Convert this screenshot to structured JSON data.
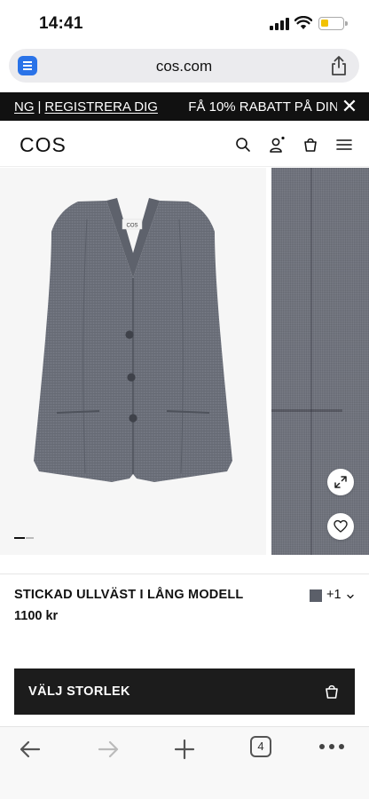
{
  "status_bar": {
    "time": "14:41"
  },
  "browser": {
    "url": "cos.com"
  },
  "promo": {
    "left_link": "NG",
    "separator": "|",
    "register_link": "REGISTRERA DIG",
    "offer_text": "FÅ 10% RABATT PÅ DIN",
    "close_glyph": "✕"
  },
  "header": {
    "logo": "COS",
    "icons": [
      "search-icon",
      "account-icon",
      "bag-icon",
      "menu-icon"
    ]
  },
  "gallery": {
    "label_tag": "COS",
    "current_slide_progress": 0.55,
    "icons": [
      "expand-icon",
      "heart-icon"
    ]
  },
  "product": {
    "name": "STICKAD ULLVÄST I LÅNG MODELL",
    "price": "1100 kr",
    "swatch_color": "#5b5f69",
    "more_colors": "+1"
  },
  "size_button": {
    "label": "VÄLJ STORLEK"
  },
  "toolbar": {
    "tab_count": "4",
    "icons": [
      "back-icon",
      "forward-icon",
      "new-tab-icon",
      "tabs-icon",
      "more-icon"
    ]
  },
  "colors": {
    "banner_bg": "#111111",
    "button_bg": "#1c1c1c",
    "product_gray": "#6e727c",
    "link_blue": "#2a73e8"
  }
}
